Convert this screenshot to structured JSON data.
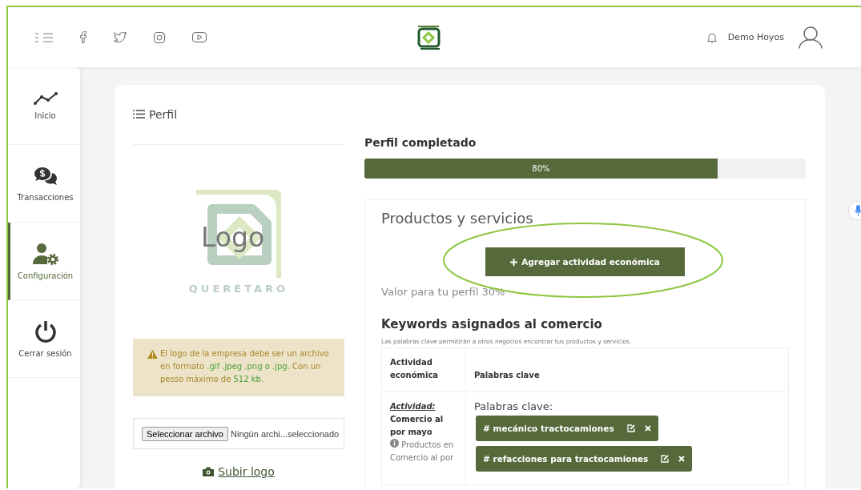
{
  "header": {
    "user_name": "Demo Hoyos"
  },
  "sidebar": {
    "items": [
      {
        "label": "Inicio",
        "selected": false
      },
      {
        "label": "Transacciones",
        "selected": false
      },
      {
        "label": "Configuración",
        "selected": true
      },
      {
        "label": "Cerrar sesión",
        "selected": false
      }
    ]
  },
  "profile": {
    "title": "Perfil",
    "logo_placeholder": {
      "word": "Logo",
      "city": "QUERÉTARO"
    },
    "notice": [
      {
        "text": "El logo de la empresa debe ser un archivo en formato ",
        "highlight": false
      },
      {
        "text": ".gif .jpeg .png o .jpg.",
        "highlight": true
      },
      {
        "text": " Con un pesso máximo de ",
        "highlight": false
      },
      {
        "text": "512 kb.",
        "highlight": true
      }
    ],
    "file_button": "Seleccionar archivo",
    "file_name": "Ningún archi...seleccionado",
    "upload_link": "Subir logo"
  },
  "completion": {
    "title": "Perfil completado",
    "level": 0.8,
    "reading": "80%"
  },
  "products": {
    "title": "Productos y servicios",
    "add_button": "Agregar actividad económica",
    "value_note": "Valor para tu perfil 30%",
    "keywords_title": "Keywords asignados al comercio",
    "keywords_note": "Las palabras clave permitirán a otros negocios encontrar tus productos y servicios.",
    "table": {
      "columns": [
        "Actividad económica",
        "Palabras clave"
      ],
      "rows": [
        {
          "activity_label": "Actividad:",
          "activity": "Comercio al por mayo",
          "info": "Productos en Comercio al por",
          "keywords_label": "Palabras clave:",
          "keywords": [
            "# mecánico tractocamiones",
            "# refacciones para tractocamiones"
          ]
        }
      ]
    }
  }
}
